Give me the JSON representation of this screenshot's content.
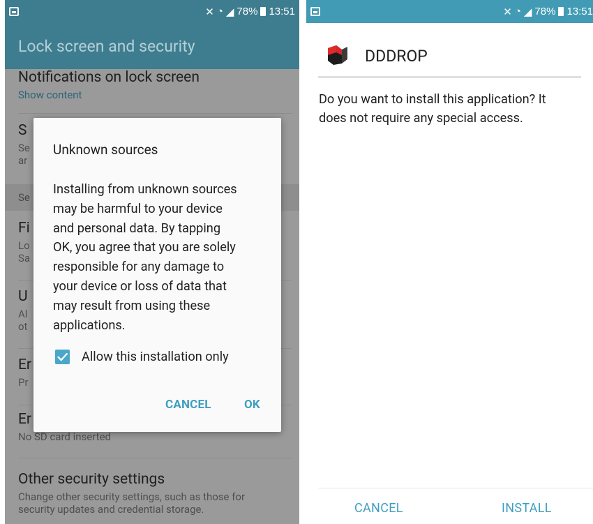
{
  "status_bar": {
    "battery": "78%",
    "time": "13:51"
  },
  "left_screen": {
    "app_bar_title": "Lock screen and security",
    "settings": [
      {
        "title": "Notifications on lock screen",
        "subtitle": "Show content"
      },
      {
        "title": "S",
        "subtitle_lines": [
          "Se",
          "ar"
        ]
      },
      {
        "section": "Se"
      },
      {
        "title": "Fi",
        "subtitle_lines": [
          "Lo",
          "Sa"
        ]
      },
      {
        "title": "U",
        "subtitle_lines": [
          "Al",
          "ot"
        ]
      },
      {
        "title": "Er",
        "subtitle": "Pr"
      },
      {
        "title": "Er",
        "subtitle": "No SD card inserted"
      },
      {
        "title": "Other security settings",
        "subtitle_lines": [
          "Change other security settings, such as those for",
          "security updates and credential storage."
        ]
      }
    ],
    "dialog": {
      "title": "Unknown sources",
      "body_lines": [
        "Installing from unknown sources",
        "may be harmful to your device",
        "and personal data. By tapping",
        "OK, you agree that you are solely",
        "responsible for any damage to",
        "your device or loss of data that",
        "may result from using these",
        "applications."
      ],
      "checkbox_label": "Allow this installation only",
      "checkbox_checked": true,
      "cancel_label": "CANCEL",
      "ok_label": "OK"
    }
  },
  "right_screen": {
    "app_name": "DDDROP",
    "message_lines": [
      "Do you want to install this application? It",
      "does not require any special access."
    ],
    "cancel_label": "CANCEL",
    "install_label": "INSTALL"
  },
  "colors": {
    "accent": "#3e9ec1",
    "app_bar": "#3e7d8f",
    "status_bar_right": "#429bb5"
  },
  "icons": [
    "picture-icon",
    "mute-icon",
    "wifi-icon",
    "signal-icon",
    "battery-icon",
    "checkmark-icon",
    "app-icon"
  ]
}
